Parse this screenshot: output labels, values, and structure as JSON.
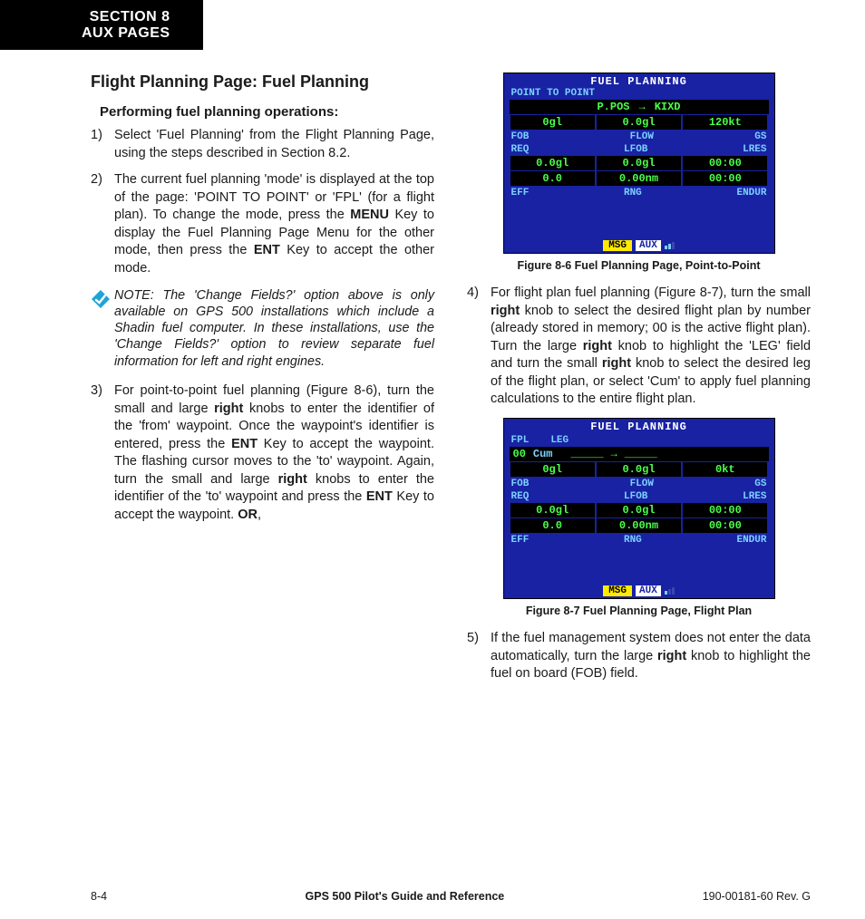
{
  "section_tab": {
    "l1": "SECTION 8",
    "l2": "AUX PAGES"
  },
  "page_heading": "Flight Planning Page: Fuel Planning",
  "subheading": "Performing fuel planning operations:",
  "steps": {
    "s1_num": "1)",
    "s1": "Select 'Fuel Planning' from the Flight Planning Page, using the steps described in Section 8.2.",
    "s2_num": "2)",
    "s2a": "The current fuel planning 'mode' is displayed at the top of the page: 'POINT TO POINT' or 'FPL' (for a flight plan).  To change the mode, press the ",
    "s2_menu": "MENU",
    "s2b": " Key to display the Fuel Planning Page Menu for the other mode, then press the ",
    "s2_ent": "ENT",
    "s2c": " Key to accept the other mode.",
    "s3_num": "3)",
    "s3a": "For point-to-point fuel planning (Figure 8-6), turn the small and large ",
    "s3_r1": "right",
    "s3b": " knobs to enter the identifier of the 'from' waypoint.  Once the waypoint's identifier is entered, press the ",
    "s3_ent": "ENT",
    "s3c": " Key to accept the waypoint.  The flashing cursor moves to the 'to' waypoint.  Again, turn the small and large ",
    "s3_r2": "right",
    "s3d": " knobs to enter the identifier of the 'to' waypoint and press the ",
    "s3_ent2": "ENT",
    "s3e": " Key to accept the waypoint. ",
    "s3_or": "OR",
    "s3f": ",",
    "s4_num": "4)",
    "s4a": "For flight plan fuel planning (Figure 8-7), turn the small ",
    "s4_r1": "right",
    "s4b": " knob to select the desired flight plan by number (already stored in memory; 00 is the active flight plan).  Turn the large ",
    "s4_r2": "right",
    "s4c": " knob to highlight the 'LEG' field and turn the small ",
    "s4_r3": "right",
    "s4d": " knob to select the desired leg of the flight plan, or select 'Cum' to apply fuel planning calculations to the entire flight plan.",
    "s5_num": "5)",
    "s5a": "If the fuel management system does not enter the data automatically, turn the large ",
    "s5_r": "right",
    "s5b": " knob to highlight the fuel on board (FOB) field."
  },
  "note": "NOTE:  The 'Change Fields?' option above is only available on GPS 500 installations which include a Shadin fuel computer.  In these installations, use the 'Change Fields?' option to review separate fuel information for left and right engines.",
  "fig86": {
    "caption": "Figure 8-6  Fuel Planning Page, Point-to-Point",
    "title": "FUEL PLANNING",
    "mode": "POINT TO POINT",
    "route_from": "P.POS",
    "route_arrow": "→",
    "route_to": "KIXD",
    "row1": [
      "0gl",
      "0.0gl",
      "120kt"
    ],
    "lbl1": [
      "FOB",
      "FLOW",
      "GS"
    ],
    "lbl2": [
      "REQ",
      "LFOB",
      "LRES"
    ],
    "row2": [
      "0.0gl",
      "0.0gl",
      "00:00"
    ],
    "row3": [
      "0.0",
      "0.00nm",
      "00:00"
    ],
    "lbl3": [
      "EFF",
      "RNG",
      "ENDUR"
    ],
    "msg": "MSG",
    "aux": "AUX"
  },
  "fig87": {
    "caption": "Figure 8-7  Fuel Planning Page, Flight Plan",
    "title": "FUEL PLANNING",
    "mode_l": "FPL",
    "mode_r": "LEG",
    "fpl_num": "00",
    "leg_val": "Cum",
    "route_from": "_____",
    "route_arrow": "→",
    "route_to": "_____",
    "row1": [
      "0gl",
      "0.0gl",
      "0kt"
    ],
    "lbl1": [
      "FOB",
      "FLOW",
      "GS"
    ],
    "lbl2": [
      "REQ",
      "LFOB",
      "LRES"
    ],
    "row2": [
      "0.0gl",
      "0.0gl",
      "00:00"
    ],
    "row3": [
      "0.0",
      "0.00nm",
      "00:00"
    ],
    "lbl3": [
      "EFF",
      "RNG",
      "ENDUR"
    ],
    "msg": "MSG",
    "aux": "AUX"
  },
  "footer": {
    "page": "8-4",
    "title": "GPS 500 Pilot's Guide and Reference",
    "rev": "190-00181-60  Rev. G"
  }
}
